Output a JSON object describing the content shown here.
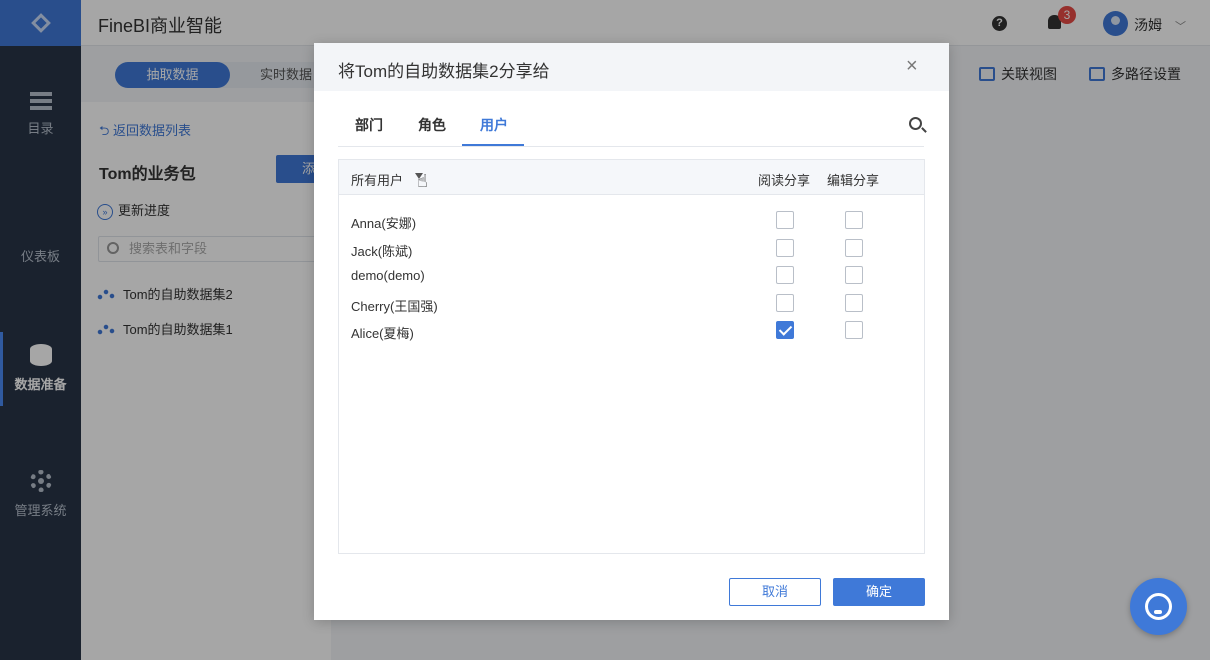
{
  "app": {
    "title": "FineBI商业智能"
  },
  "header": {
    "notification_count": "3",
    "user_name": "汤姆"
  },
  "nav": [
    {
      "label": "目录",
      "icon": "list-icon"
    },
    {
      "label": "仪表板",
      "icon": "dashboard-icon"
    },
    {
      "label": "数据准备",
      "icon": "database-icon",
      "active": true
    },
    {
      "label": "管理系统",
      "icon": "gear-icon"
    }
  ],
  "subbar": {
    "mode_extract": "抽取数据",
    "mode_realtime": "实时数据",
    "link_relation_view": "关联视图",
    "link_multipath": "多路径设置"
  },
  "panel": {
    "back_link": "返回数据列表",
    "package_title": "Tom的业务包",
    "add_button": "添",
    "update_progress": "更新进度",
    "search_placeholder": "搜索表和字段",
    "datasets": [
      "Tom的自助数据集2",
      "Tom的自助数据集1"
    ]
  },
  "dialog": {
    "title": "将Tom的自助数据集2分享给",
    "tabs": [
      "部门",
      "角色",
      "用户"
    ],
    "active_tab": "用户",
    "table": {
      "col_all_users": "所有用户",
      "col_read_share": "阅读分享",
      "col_edit_share": "编辑分享",
      "rows": [
        {
          "name": "Anna(安娜)",
          "read": false,
          "edit": false
        },
        {
          "name": "Jack(陈斌)",
          "read": false,
          "edit": false
        },
        {
          "name": "demo(demo)",
          "read": false,
          "edit": false
        },
        {
          "name": "Cherry(王国强)",
          "read": false,
          "edit": false
        },
        {
          "name": "Alice(夏梅)",
          "read": true,
          "edit": false
        }
      ]
    },
    "cancel_label": "取消",
    "confirm_label": "确定"
  },
  "colors": {
    "accent": "#3f79d8",
    "nav_bg": "#283548",
    "badge": "#e64a45"
  }
}
